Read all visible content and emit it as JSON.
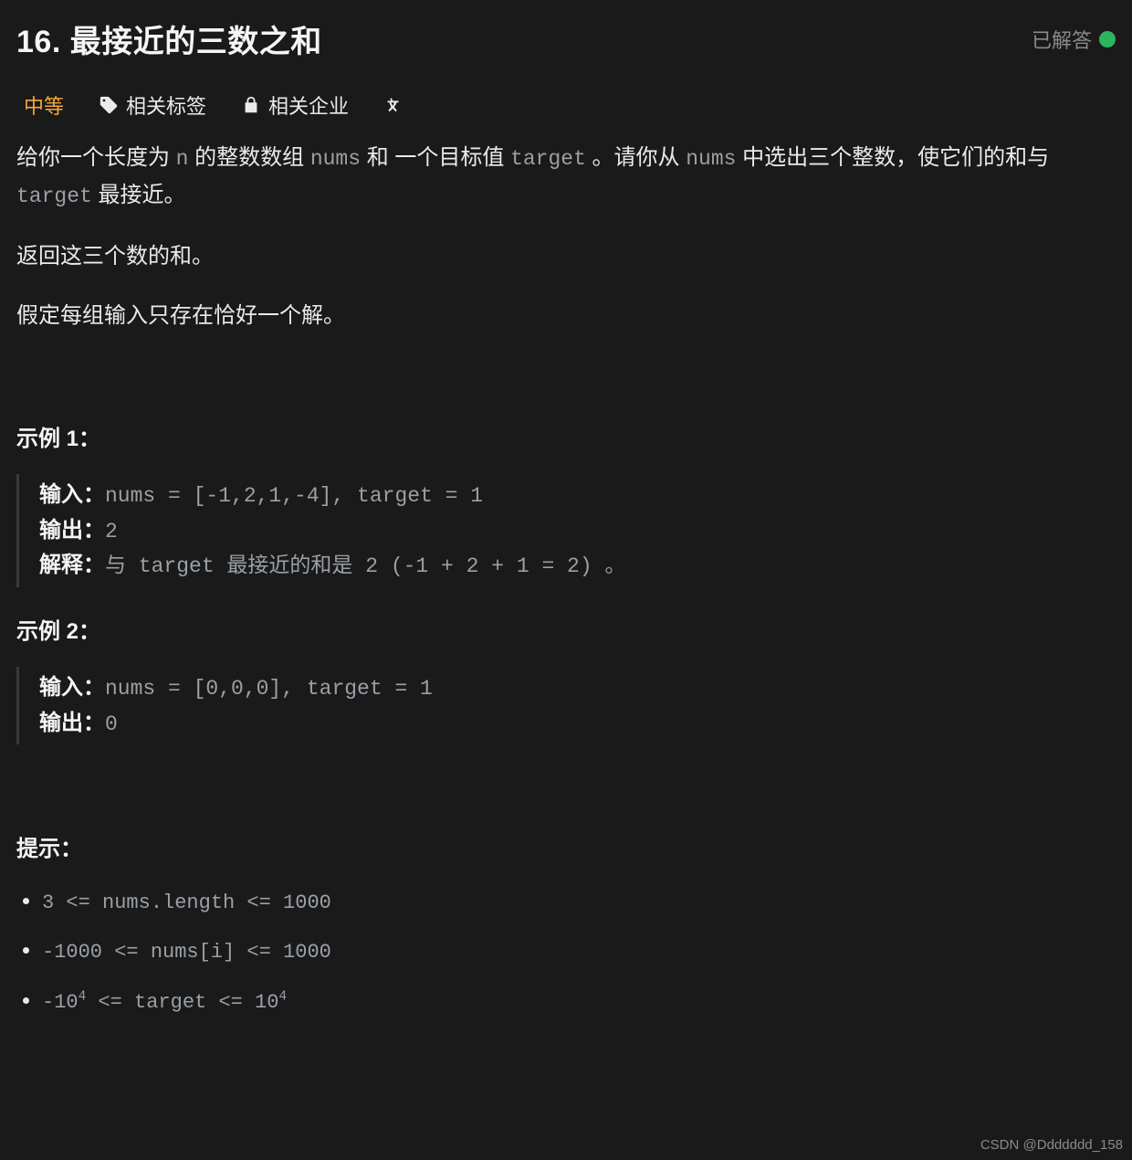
{
  "header": {
    "title": "16. 最接近的三数之和",
    "status_text": "已解答"
  },
  "tabs": {
    "difficulty": "中等",
    "tags": "相关标签",
    "companies": "相关企业"
  },
  "description": {
    "p1_a": "给你一个长度为 ",
    "p1_code1": "n",
    "p1_b": " 的整数数组 ",
    "p1_code2": "nums",
    "p1_c": " 和 一个目标值 ",
    "p1_code3": "target",
    "p1_d": " 。请你从 ",
    "p1_code4": "nums",
    "p1_e": " 中选出三个整数，使它们的和与 ",
    "p1_code5": "target",
    "p1_f": " 最接近。",
    "p2": "返回这三个数的和。",
    "p3": "假定每组输入只存在恰好一个解。"
  },
  "examples": {
    "heading1": "示例 1：",
    "ex1": {
      "input_label": "输入：",
      "input_value": "nums = [-1,2,1,-4], target = 1",
      "output_label": "输出：",
      "output_value": "2",
      "explain_label": "解释：",
      "explain_value": "与 target 最接近的和是 2 (-1 + 2 + 1 = 2) 。"
    },
    "heading2": "示例 2：",
    "ex2": {
      "input_label": "输入：",
      "input_value": "nums = [0,0,0], target = 1",
      "output_label": "输出：",
      "output_value": "0"
    }
  },
  "constraints": {
    "heading": "提示：",
    "c1": "3 <= nums.length <= 1000",
    "c2": "-1000 <= nums[i] <= 1000",
    "c3_a": "-10",
    "c3_sup1": "4",
    "c3_b": " <= target <= 10",
    "c3_sup2": "4"
  },
  "watermark": "CSDN @Ddddddd_158"
}
